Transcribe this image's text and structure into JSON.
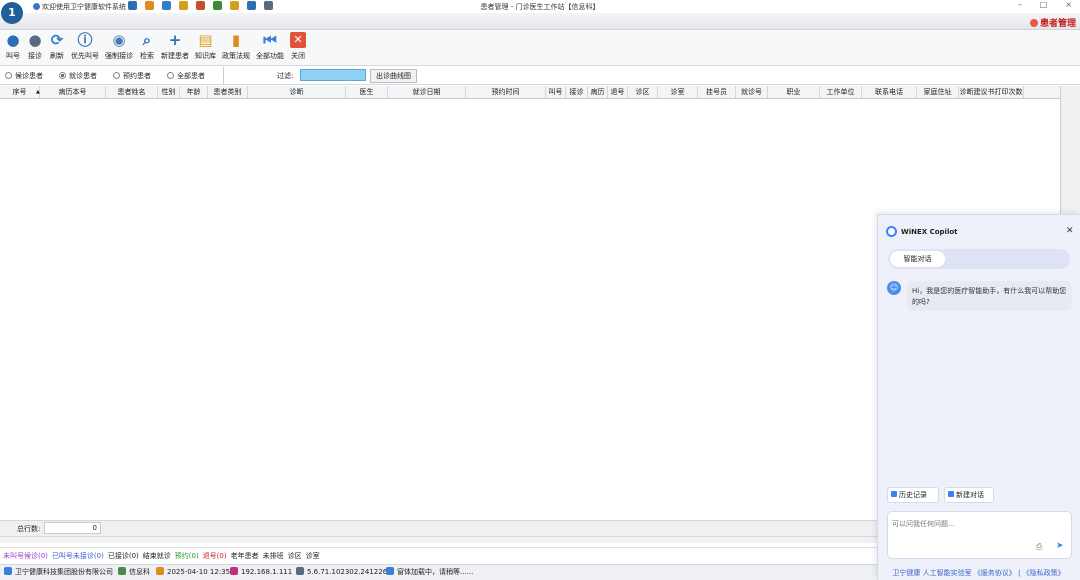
{
  "app": {
    "logo_text": "1",
    "welcome_text": "欢迎使用卫宁健康软件系统",
    "window_title": "患者管理 - 门诊医生工作站【信息科】",
    "window_controls": [
      "–",
      "□",
      "×"
    ],
    "module_label": "患者管理"
  },
  "title_icons": [
    "home-icon",
    "document-icon",
    "refresh-icon",
    "lock-icon",
    "user-icon",
    "globe-icon",
    "key-icon",
    "help-icon",
    "users-icon"
  ],
  "toolbar": [
    {
      "label": "叫号",
      "icon": "user-icon",
      "color": "#2f6db5",
      "glyph": "●"
    },
    {
      "label": "接诊",
      "icon": "user-gear-icon",
      "color": "#5a6b80",
      "glyph": "●"
    },
    {
      "label": "刷新",
      "icon": "refresh-icon",
      "color": "#2f7fd0",
      "glyph": "⟳"
    },
    {
      "label": "优先叫号",
      "icon": "info-icon",
      "color": "#2f6db5",
      "glyph": "ⓘ"
    },
    {
      "label": "强制接诊",
      "icon": "shield-icon",
      "color": "#4a78b8",
      "glyph": "◉"
    },
    {
      "label": "检索",
      "icon": "search-icon",
      "color": "#2f6db5",
      "glyph": "⌕"
    },
    {
      "label": "新建患者",
      "icon": "plus-icon",
      "color": "#2f6db5",
      "glyph": "+"
    },
    {
      "label": "知识库",
      "icon": "book-icon",
      "color": "#e0a020",
      "glyph": "▤"
    },
    {
      "label": "政策法规",
      "icon": "bar-chart-icon",
      "color": "#e08a20",
      "glyph": "▮"
    },
    {
      "label": "全部功能",
      "icon": "skip-back-icon",
      "color": "#3b7dd8",
      "glyph": "⏮"
    },
    {
      "label": "关闭",
      "icon": "close-icon",
      "color": "#e0533a",
      "glyph": "✕"
    }
  ],
  "filters": {
    "options": [
      "候诊患者",
      "就诊患者",
      "预约患者",
      "全部患者"
    ],
    "selected": "就诊患者",
    "filter_label": "过滤:",
    "filter_value": "",
    "chart_button": "出诊曲线图"
  },
  "table": {
    "columns": [
      "序号",
      "病历本号",
      "患者姓名",
      "性别",
      "年龄",
      "患者类别",
      "诊断",
      "医生",
      "就诊日期",
      "预约时间",
      "叫号",
      "接诊",
      "病历",
      "退号",
      "诊区",
      "诊室",
      "挂号员",
      "就诊号",
      "职业",
      "工作单位",
      "联系电话",
      "家庭住址",
      "诊断建议书打印次数"
    ],
    "sort_indicator": "▲"
  },
  "total": {
    "label": "总行数:",
    "value": "0"
  },
  "legend": [
    {
      "text": "未叫号候诊(0)",
      "color": "#9b3dc9"
    },
    {
      "text": "已叫号未接诊(0)",
      "color": "#3a5fd0"
    },
    {
      "text": "已接诊(0)",
      "color": "#222222"
    },
    {
      "text": "结束就诊",
      "color": "#222222"
    },
    {
      "text": "预约(0)",
      "color": "#2a9a2a"
    },
    {
      "text": "退号(0)",
      "color": "#d02020"
    },
    {
      "text": "老年患者",
      "color": "#222222"
    },
    {
      "text": "未排班",
      "color": "#222222"
    },
    {
      "text": "诊区",
      "color": "#222222"
    },
    {
      "text": "诊室",
      "color": "#222222"
    }
  ],
  "status": [
    {
      "text": "卫宁健康科技集团股份有限公司",
      "icon": "company-icon",
      "color": "#3b7dd8"
    },
    {
      "text": "信息科",
      "icon": "dept-icon",
      "color": "#4a8a4a"
    },
    {
      "text": "2025-04-10 12:35",
      "icon": "clock-icon",
      "color": "#e08a20"
    },
    {
      "text": "192.168.1.111",
      "icon": "network-icon",
      "color": "#c03080"
    },
    {
      "text": "5.6.71.102302.241226",
      "icon": "version-icon",
      "color": "#5a6b80"
    },
    {
      "text": "窗体加载中，请稍等......",
      "icon": "loading-icon",
      "color": "#3b7dd8"
    }
  ],
  "copilot": {
    "title": "WiNEX Copilot",
    "tab": "智能对话",
    "greeting": "Hi，我是您的医疗智能助手，有什么我可以帮助您的吗?",
    "history_button": "历史记录",
    "new_chat_button": "新建对话",
    "input_placeholder": "可以问我任何问题...",
    "footer": "卫宁健康 人工智能实验室 《服务协议》 | 《隐私政策》"
  }
}
